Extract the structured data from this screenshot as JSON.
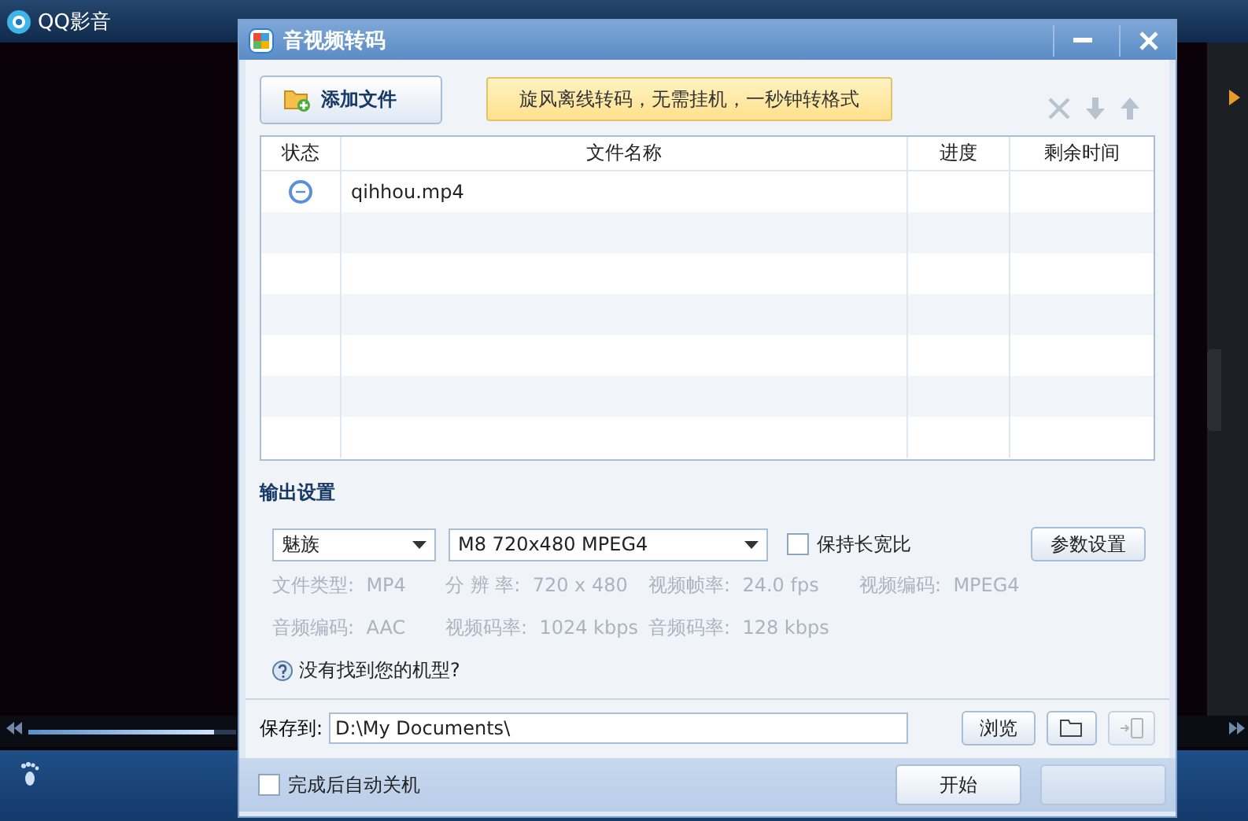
{
  "player": {
    "title": "QQ影音"
  },
  "dialog": {
    "title": "音视频转码",
    "add_file_button": "添加文件",
    "banner": "旋风离线转码，无需挂机，一秒钟转格式",
    "table": {
      "columns": [
        "状态",
        "文件名称",
        "进度",
        "剩余时间"
      ],
      "rows": [
        {
          "kind": "waiting",
          "name": "qihhou.mp4"
        }
      ]
    },
    "output": {
      "heading": "输出设置",
      "brand": "魅族",
      "model": "M8 720x480 MPEG4",
      "keep_ratio": {
        "label": "保持长宽比",
        "checked": false
      },
      "params_button": "参数设置",
      "info": [
        {
          "label": "文件类型:",
          "value": "MP4"
        },
        {
          "label": "分 辨 率:",
          "value": "720 x 480"
        },
        {
          "label": "视频帧率:",
          "value": "24.0 fps"
        },
        {
          "label": "视频编码:",
          "value": "MPEG4"
        },
        {
          "label": "音频编码:",
          "value": "AAC"
        },
        {
          "label": "视频码率:",
          "value": "1024 kbps"
        },
        {
          "label": "音频码率:",
          "value": "128 kbps"
        }
      ],
      "help": "没有找到您的机型?"
    },
    "save": {
      "label": "保存到:",
      "path": "D:\\My Documents\\",
      "browse_button": "浏览"
    },
    "footer": {
      "shutdown": {
        "label": "完成后自动关机",
        "checked": false
      },
      "start_button": "开始"
    }
  }
}
